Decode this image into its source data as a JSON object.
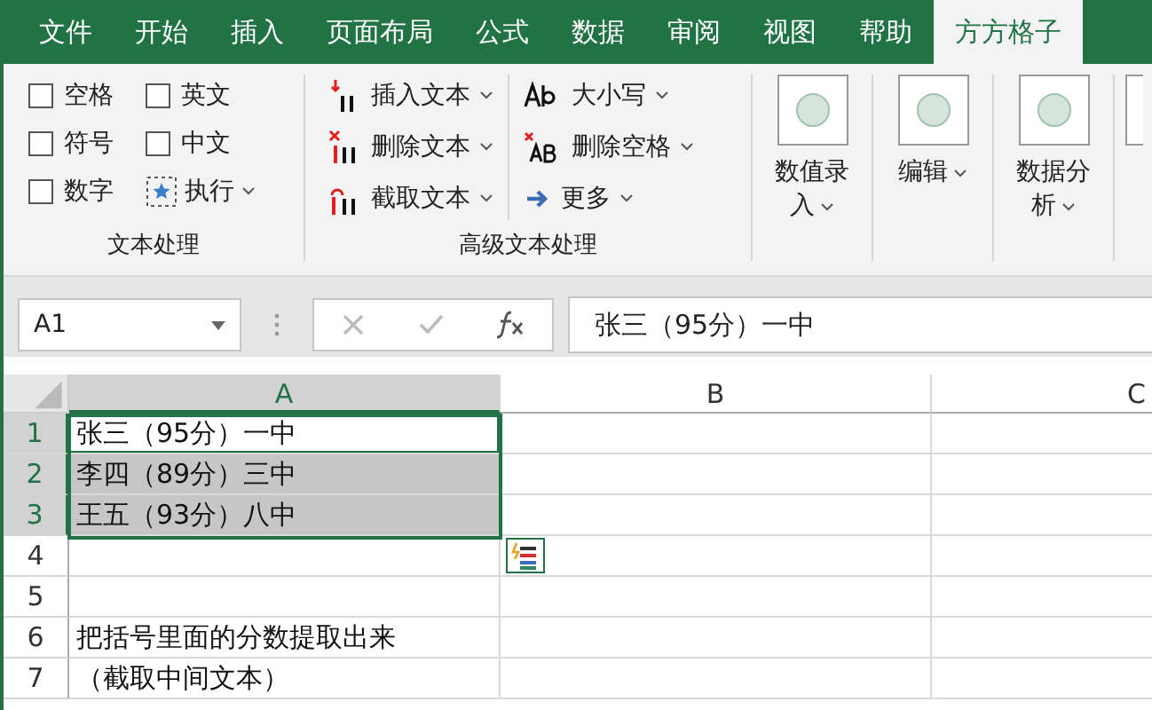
{
  "tabs": [
    {
      "label": "文件",
      "selected": false
    },
    {
      "label": "开始",
      "selected": false
    },
    {
      "label": "插入",
      "selected": false
    },
    {
      "label": "页面布局",
      "selected": false
    },
    {
      "label": "公式",
      "selected": false
    },
    {
      "label": "数据",
      "selected": false
    },
    {
      "label": "审阅",
      "selected": false
    },
    {
      "label": "视图",
      "selected": false
    },
    {
      "label": "帮助",
      "selected": false
    },
    {
      "label": "方方格子",
      "selected": true
    }
  ],
  "ribbon": {
    "text_group": {
      "label": "文本处理",
      "checkboxes": [
        {
          "label": "空格",
          "checked": false
        },
        {
          "label": "英文",
          "checked": false
        },
        {
          "label": "符号",
          "checked": false
        },
        {
          "label": "中文",
          "checked": false
        },
        {
          "label": "数字",
          "checked": false
        }
      ],
      "action": {
        "label": "执行"
      }
    },
    "advanced_group": {
      "label": "高级文本处理",
      "columns": [
        [
          {
            "kind": "insert",
            "label": "插入文本"
          },
          {
            "kind": "delete",
            "label": "删除文本"
          },
          {
            "kind": "extract",
            "label": "截取文本"
          }
        ],
        [
          {
            "kind": "case",
            "label": "大小写"
          },
          {
            "kind": "trim",
            "label": "删除空格"
          },
          {
            "kind": "more",
            "label": "更多"
          }
        ]
      ]
    },
    "big_buttons": [
      {
        "label": "数值录入"
      },
      {
        "label": "编辑"
      },
      {
        "label": "数据分析"
      }
    ]
  },
  "formula_bar": {
    "name_box": "A1",
    "formula": "张三（95分）一中"
  },
  "sheet": {
    "columns": [
      {
        "label": "A",
        "selected": true
      },
      {
        "label": "B",
        "selected": false
      },
      {
        "label": "C",
        "selected": false
      }
    ],
    "rows": [
      {
        "header": "1",
        "selected": true,
        "cells": [
          {
            "text": "张三（95分）一中",
            "selected": true,
            "active": true
          }
        ]
      },
      {
        "header": "2",
        "selected": true,
        "cells": [
          {
            "text": "李四（89分）三中",
            "selected": true,
            "active": false
          }
        ]
      },
      {
        "header": "3",
        "selected": true,
        "cells": [
          {
            "text": "王五（93分）八中",
            "selected": true,
            "active": false
          }
        ]
      },
      {
        "header": "4",
        "selected": false,
        "cells": []
      },
      {
        "header": "5",
        "selected": false,
        "cells": []
      },
      {
        "header": "6",
        "selected": false,
        "cells": [
          {
            "text": "把括号里面的分数提取出来",
            "selected": false,
            "active": false
          }
        ]
      },
      {
        "header": "7",
        "selected": false,
        "cells": [
          {
            "text": "（截取中间文本）",
            "selected": false,
            "active": false
          }
        ]
      }
    ]
  }
}
